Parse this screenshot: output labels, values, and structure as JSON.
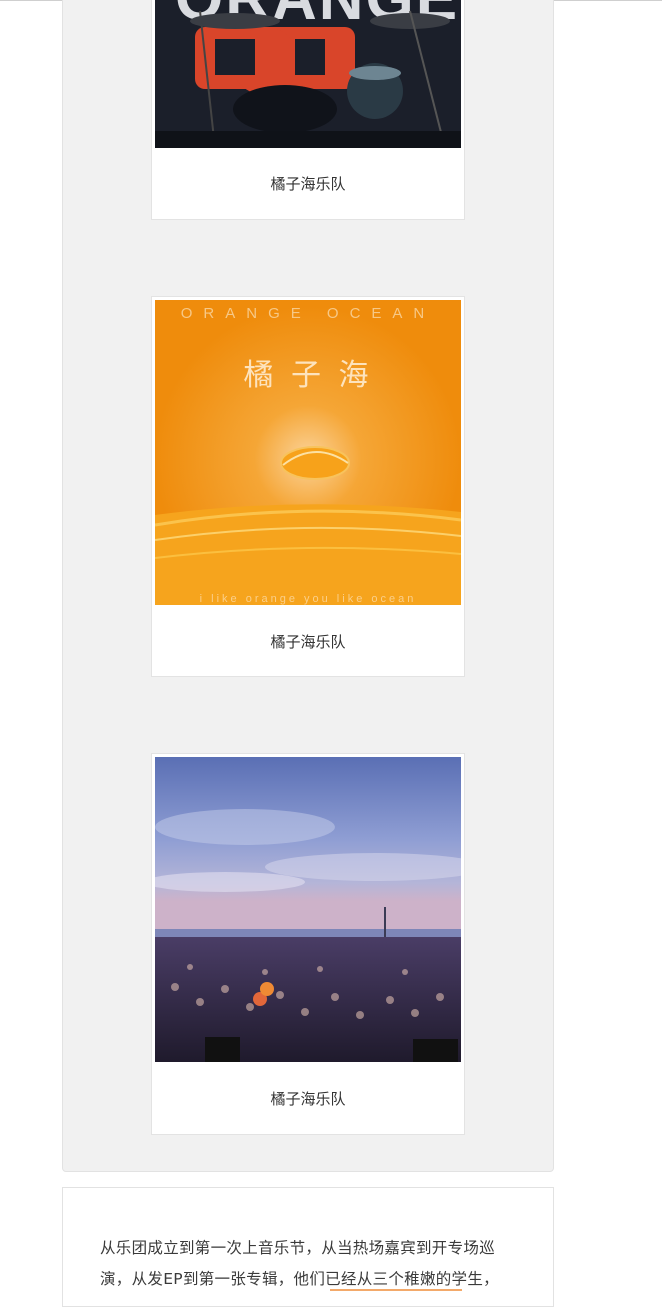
{
  "gallery": {
    "cards": [
      {
        "caption": "橘子海乐队",
        "image": "band-stage-photo",
        "logo_text": "ORANGE OCEAN"
      },
      {
        "caption": "橘子海乐队",
        "image": "album-cover",
        "cover_top_text": "ORANGE OCEAN",
        "cover_title": "橘 子 海",
        "cover_bottom_text": "i like orange you like ocean"
      },
      {
        "caption": "橘子海乐队",
        "image": "crowd-beach-photo"
      }
    ]
  },
  "article": {
    "paragraph": "从乐团成立到第一次上音乐节，从当热场嘉宾到开专场巡演，从发EP到第一张专辑，他们已经从三个稚嫩的学生，"
  },
  "colors": {
    "panel_bg": "#f1f1f1",
    "orange": "#f39211"
  }
}
